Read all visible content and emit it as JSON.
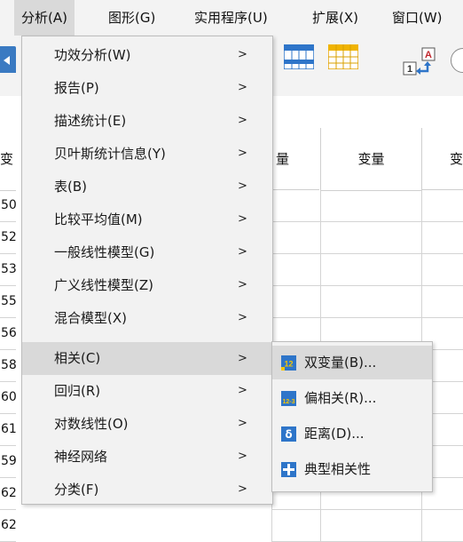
{
  "menubar": [
    {
      "label": "分析(A)",
      "active": true
    },
    {
      "label": "图形(G)"
    },
    {
      "label": "实用程序(U)"
    },
    {
      "label": "扩展(X)"
    },
    {
      "label": "窗口(W)"
    }
  ],
  "grid": {
    "column_headers": [
      "变",
      "量",
      "变量",
      "变"
    ],
    "row_headers": [
      "50",
      "52",
      "53",
      "55",
      "56",
      "58",
      "60",
      "61",
      "59",
      "62",
      "62"
    ]
  },
  "menu": [
    {
      "label": "功效分析(W)"
    },
    {
      "label": "报告(P)"
    },
    {
      "label": "描述统计(E)"
    },
    {
      "label": "贝叶斯统计信息(Y)"
    },
    {
      "label": "表(B)"
    },
    {
      "label": "比较平均值(M)"
    },
    {
      "label": "一般线性模型(G)"
    },
    {
      "label": "广义线性模型(Z)"
    },
    {
      "label": "混合模型(X)"
    },
    {
      "label": "相关(C)",
      "highlighted": true
    },
    {
      "label": "回归(R)"
    },
    {
      "label": "对数线性(O)"
    },
    {
      "label": "神经网络"
    },
    {
      "label": "分类(F)"
    }
  ],
  "submenu": [
    {
      "label": "双变量(B)...",
      "icon": "bivariate-icon",
      "highlighted": true
    },
    {
      "label": "偏相关(R)...",
      "icon": "partial-correlation-icon"
    },
    {
      "label": "距离(D)...",
      "icon": "distance-icon"
    },
    {
      "label": "典型相关性",
      "icon": "canonical-correlation-icon"
    }
  ],
  "colors": {
    "menubar_bg": "#f3f3f3",
    "menu_bg": "#f2f2f2",
    "highlight": "#d9d9d9",
    "icon_blue": "#2e75c9"
  }
}
